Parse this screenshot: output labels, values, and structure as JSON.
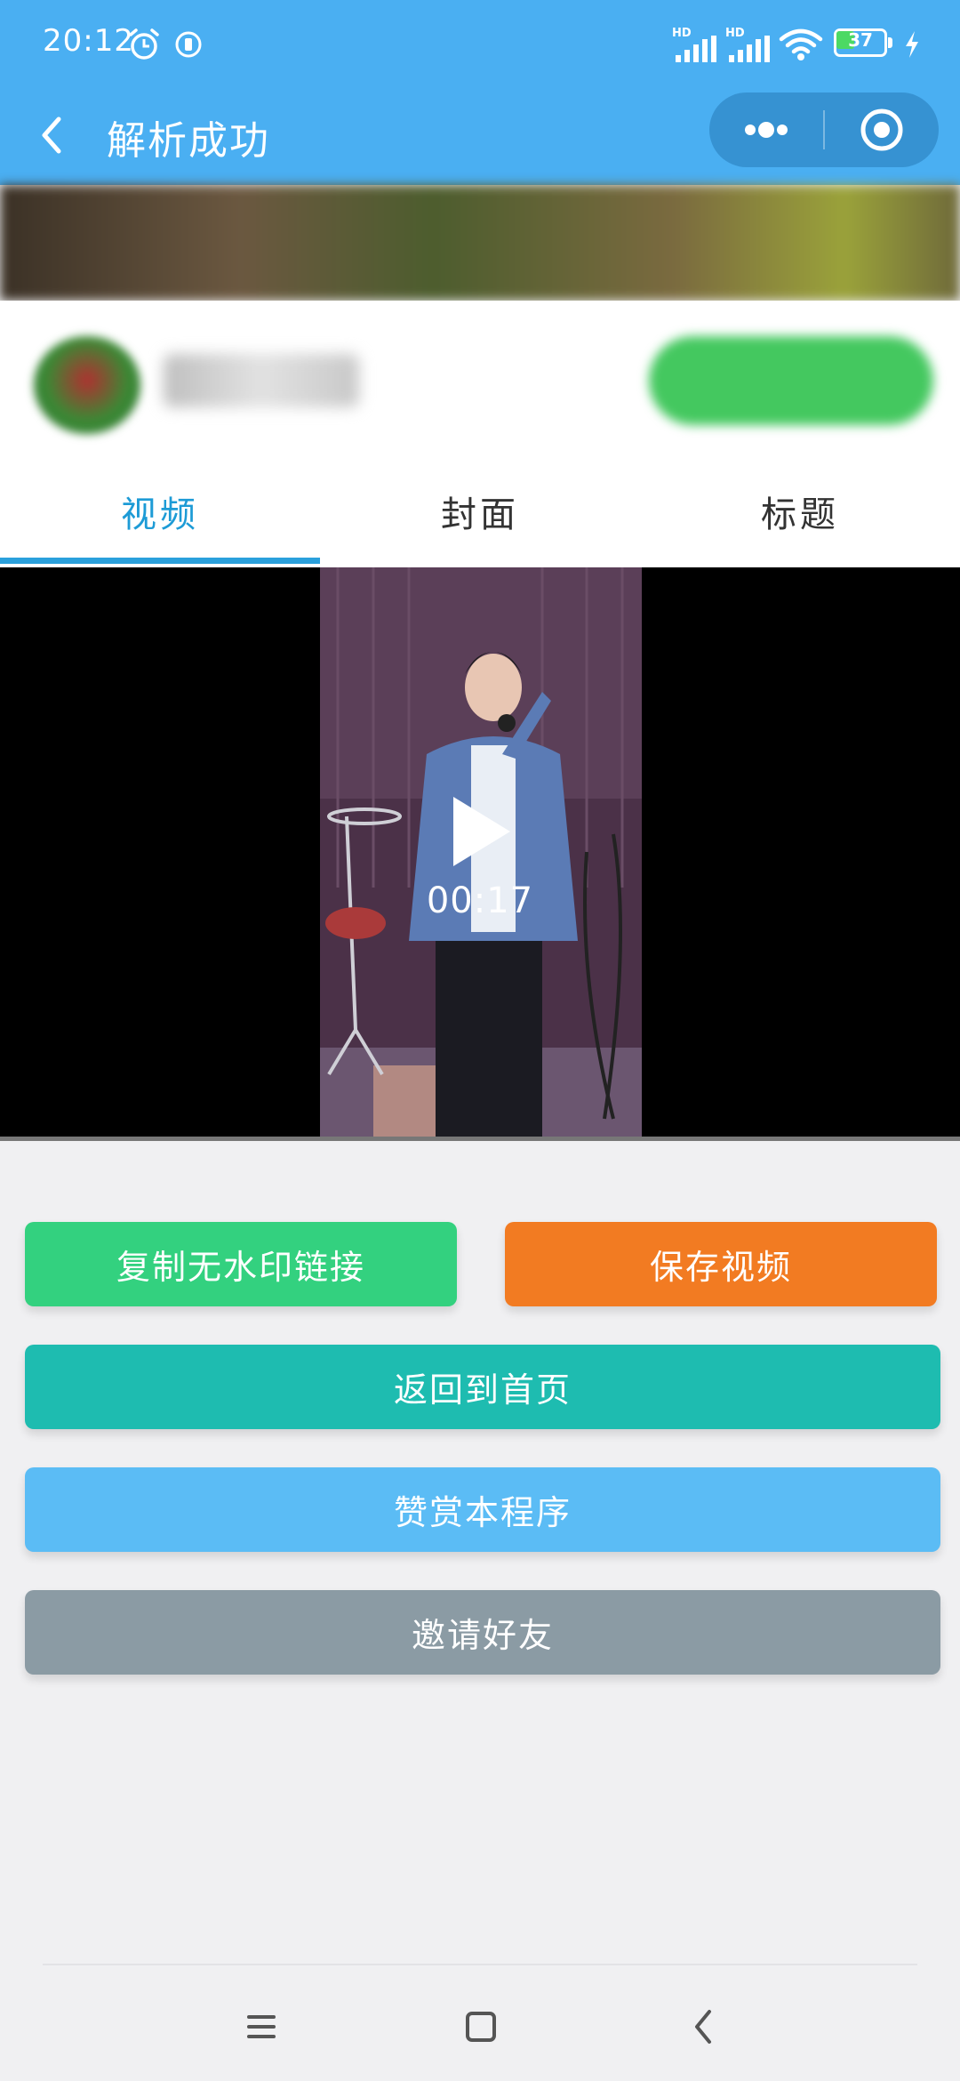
{
  "status_bar": {
    "time": "20:12",
    "signal_1_label": "HD",
    "signal_2_label": "HD",
    "battery_level": "37"
  },
  "nav": {
    "title": "解析成功",
    "icons": [
      "back-icon",
      "more-dots-icon",
      "close-target-icon"
    ]
  },
  "tabs": [
    {
      "label": "视频",
      "active": true
    },
    {
      "label": "封面",
      "active": false
    },
    {
      "label": "标题",
      "active": false
    }
  ],
  "video": {
    "duration": "00:17"
  },
  "actions": {
    "copy_label": "复制无水印链接",
    "save_label": "保存视频",
    "home_label": "返回到首页",
    "reward_label": "赞赏本程序",
    "invite_label": "邀请好友"
  },
  "colors": {
    "header": "#4aaff2",
    "tab_active": "#1d9bd6",
    "copy": "#33d17f",
    "save": "#f27b22",
    "home": "#1ebcb0",
    "reward": "#5bbcf5",
    "invite": "#8b9ba4"
  },
  "system_nav": {
    "icons": [
      "menu-icon",
      "home-square-icon",
      "back-chevron-icon"
    ]
  }
}
